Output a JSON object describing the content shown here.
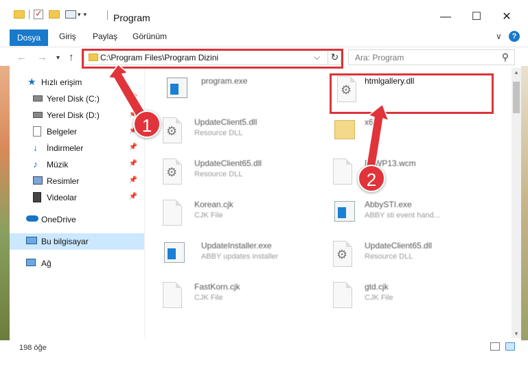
{
  "window": {
    "title": "Program",
    "controls": {
      "minimize": "—",
      "maximize": "☐",
      "close": "✕"
    }
  },
  "ribbon": {
    "tabs": [
      "Dosya",
      "Giriş",
      "Paylaş",
      "Görünüm"
    ],
    "expand": "∨",
    "help": "?"
  },
  "address": {
    "path": "C:\\Program Files\\Program Dizini",
    "search_placeholder": "Ara: Program"
  },
  "sidebar": {
    "items": [
      {
        "label": "Hızlı erişim",
        "icon": "star-icon",
        "pinned": false
      },
      {
        "label": "Yerel Disk (C:)",
        "icon": "drive-icon",
        "pinned": true
      },
      {
        "label": "Yerel Disk (D:)",
        "icon": "drive-icon",
        "pinned": true
      },
      {
        "label": "Belgeler",
        "icon": "documents-icon",
        "pinned": true
      },
      {
        "label": "İndirmeler",
        "icon": "download-icon",
        "pinned": true
      },
      {
        "label": "Müzik",
        "icon": "music-icon",
        "pinned": true
      },
      {
        "label": "Resimler",
        "icon": "pictures-icon",
        "pinned": true
      },
      {
        "label": "Videolar",
        "icon": "video-icon",
        "pinned": true
      },
      {
        "label": "OneDrive",
        "icon": "cloud-icon",
        "pinned": false
      },
      {
        "label": "Bu bilgisayar",
        "icon": "computer-icon",
        "pinned": false,
        "selected": true
      },
      {
        "label": "Ağ",
        "icon": "network-icon",
        "pinned": false
      }
    ]
  },
  "files": [
    {
      "name": "program.exe",
      "type": ""
    },
    {
      "name": "htmlgallery.dll",
      "type": "",
      "highlighted": true
    },
    {
      "name": "UpdateClient5.dll",
      "type": "Resource DLL"
    },
    {
      "name": "x6",
      "type": ""
    },
    {
      "name": "UpdateClient65.dll",
      "type": "Resource DLL"
    },
    {
      "name": "FoWP13.wcm",
      "type": "File"
    },
    {
      "name": "Korean.cjk",
      "type": "CJK File"
    },
    {
      "name": "AbbySTI.exe",
      "type": "ABBY sti event hand..."
    },
    {
      "name": "UpdateInstaller.exe",
      "type": "ABBY updates installer"
    },
    {
      "name": "UpdateClient65.dll",
      "type": "Resource DLL"
    },
    {
      "name": "FastKorn.cjk",
      "type": "CJK File"
    },
    {
      "name": "gtd.cjk",
      "type": "CJK File"
    }
  ],
  "status": {
    "count": "198 öğe"
  },
  "annotations": {
    "step1": "1",
    "step2": "2"
  },
  "colors": {
    "accent": "#1979ca",
    "annotation": "#d9343a",
    "selected": "#cce8ff"
  }
}
